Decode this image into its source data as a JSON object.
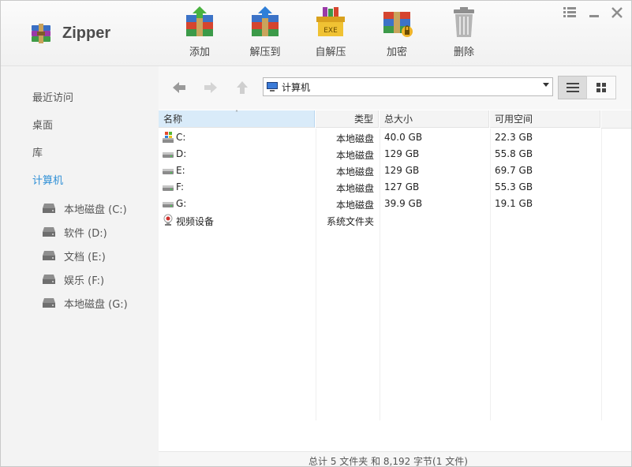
{
  "app": {
    "title": "Zipper"
  },
  "toolbar": [
    {
      "label": "添加",
      "icon": "archive-add-icon"
    },
    {
      "label": "解压到",
      "icon": "archive-extract-icon"
    },
    {
      "label": "自解压",
      "icon": "sfx-exe-icon"
    },
    {
      "label": "加密",
      "icon": "archive-lock-icon"
    },
    {
      "label": "删除",
      "icon": "trash-icon"
    }
  ],
  "window_controls": [
    "menu-icon",
    "minimize-icon",
    "close-icon"
  ],
  "sidebar": {
    "items": [
      {
        "label": "最近访问"
      },
      {
        "label": "桌面"
      },
      {
        "label": "库"
      },
      {
        "label": "计算机",
        "active": true
      }
    ],
    "drives": [
      {
        "label": "本地磁盘 (C:)"
      },
      {
        "label": "软件 (D:)"
      },
      {
        "label": "文档 (E:)"
      },
      {
        "label": "娱乐 (F:)"
      },
      {
        "label": "本地磁盘 (G:)"
      }
    ]
  },
  "path": {
    "text": "计算机"
  },
  "columns": {
    "name": "名称",
    "type": "类型",
    "size": "总大小",
    "free": "可用空间",
    "sort_indicator": "˄"
  },
  "files": [
    {
      "icon": "windows-drive-icon",
      "name": "C:",
      "type": "本地磁盘",
      "size": "40.0 GB",
      "free": "22.3 GB"
    },
    {
      "icon": "hard-drive-icon",
      "name": "D:",
      "type": "本地磁盘",
      "size": "129 GB",
      "free": "55.8 GB"
    },
    {
      "icon": "hard-drive-icon",
      "name": "E:",
      "type": "本地磁盘",
      "size": "129 GB",
      "free": "69.7 GB"
    },
    {
      "icon": "hard-drive-icon",
      "name": "F:",
      "type": "本地磁盘",
      "size": "127 GB",
      "free": "55.3 GB"
    },
    {
      "icon": "hard-drive-icon",
      "name": "G:",
      "type": "本地磁盘",
      "size": "39.9 GB",
      "free": "19.1 GB"
    },
    {
      "icon": "webcam-icon",
      "name": "视频设备",
      "type": "系统文件夹",
      "size": "",
      "free": ""
    }
  ],
  "status": {
    "text": "总计 5 文件夹 和 8,192 字节(1 文件)"
  },
  "colors": {
    "accent": "#2e8fd6",
    "selected_header": "#d9ebf9"
  }
}
